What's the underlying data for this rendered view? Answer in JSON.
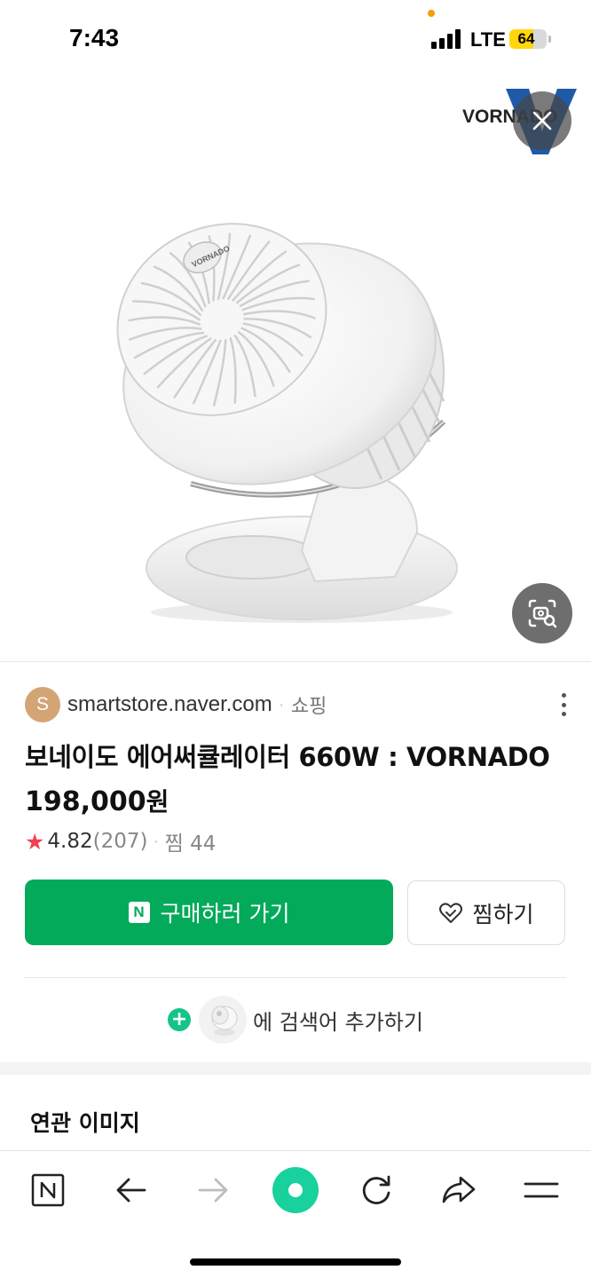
{
  "status_bar": {
    "time": "7:43",
    "network": "LTE",
    "battery_level": "64",
    "battery_percent": 64
  },
  "image_viewer": {
    "brand_logo_text": "VORNADO",
    "product_badge_text": "VORNADO",
    "close_icon": "close-icon",
    "lens_icon": "image-search-icon"
  },
  "result": {
    "source_initial": "S",
    "source_domain": "smartstore.naver.com",
    "source_separator": "·",
    "source_category": "쇼핑",
    "title": "보네이도 에어써큘레이터 660W : VORNADO",
    "price": "198,000",
    "price_unit": "원",
    "rating": "4.82",
    "review_count": "(207)",
    "rating_separator": "·",
    "wish_count": "찜 44",
    "buy_label": "구매하러 가기",
    "buy_badge": "N",
    "wish_label": "찜하기",
    "add_search_label": "에 검색어 추가하기",
    "plus_glyph": "+"
  },
  "related": {
    "title": "연관 이미지"
  },
  "bottom_nav": {
    "items": [
      "naver-home-icon",
      "back-icon",
      "forward-icon",
      "green-dot-icon",
      "refresh-icon",
      "share-icon",
      "menu-icon"
    ]
  },
  "colors": {
    "buy_green": "#03aa5a",
    "star_red": "#f24152",
    "plus_green": "#14c48a",
    "green_dot": "#19d19c",
    "battery_yellow": "#ffd60a"
  }
}
